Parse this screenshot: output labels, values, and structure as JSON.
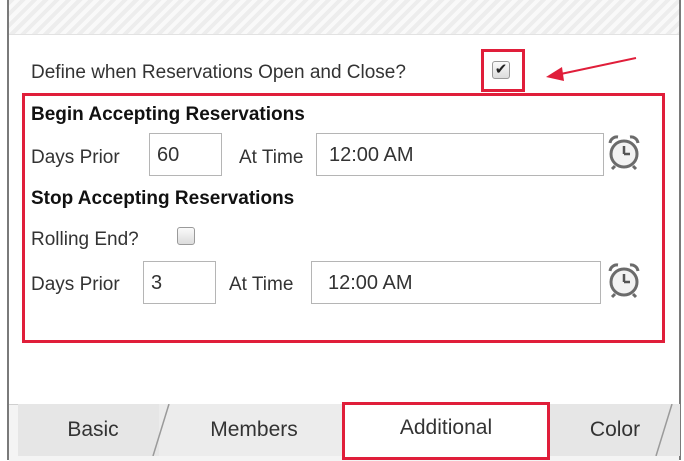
{
  "define": {
    "label": "Define when Reservations Open and Close?",
    "checked": true
  },
  "begin": {
    "heading": "Begin Accepting Reservations",
    "days_prior_label": "Days Prior",
    "days_prior_value": "60",
    "at_time_label": "At Time",
    "time_value": "12:00 AM",
    "icon": "alarm-clock-icon"
  },
  "stop": {
    "heading": "Stop Accepting Reservations",
    "rolling_end_label": "Rolling End?",
    "rolling_end_checked": false,
    "days_prior_label": "Days Prior",
    "days_prior_value": "3",
    "at_time_label": "At Time",
    "time_value": "12:00 AM",
    "icon": "alarm-clock-icon"
  },
  "tabs": [
    {
      "label": "Basic",
      "active": false
    },
    {
      "label": "Members",
      "active": false
    },
    {
      "label": "Additional",
      "active": true
    },
    {
      "label": "Color",
      "active": false
    }
  ],
  "colors": {
    "highlight": "#e01e3a",
    "text": "#333333"
  }
}
